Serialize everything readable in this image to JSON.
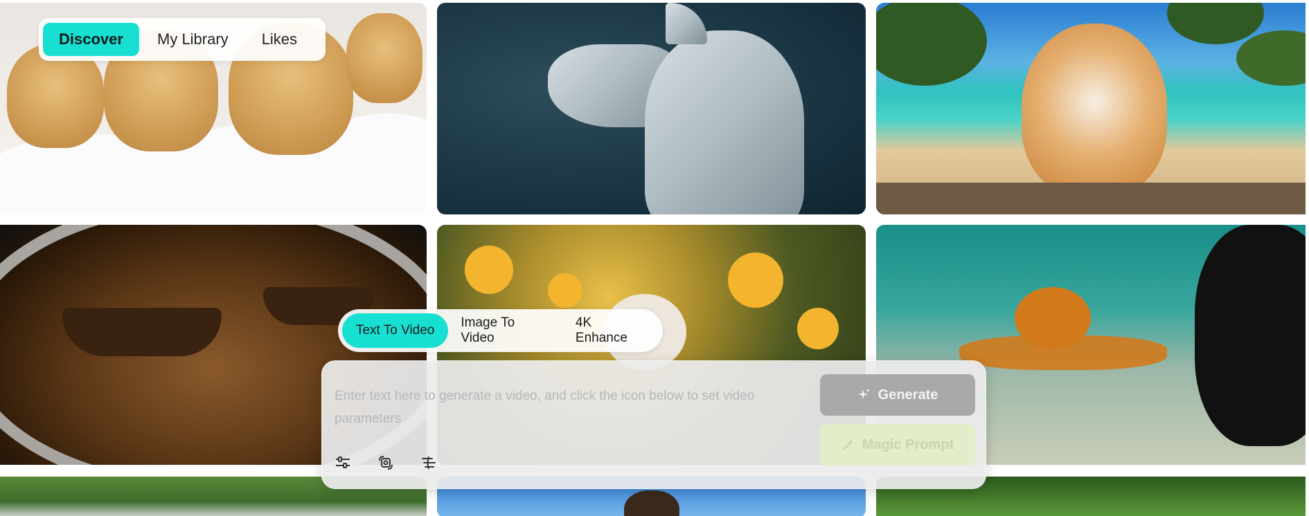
{
  "nav": {
    "tabs": [
      {
        "label": "Discover",
        "active": true
      },
      {
        "label": "My Library",
        "active": false
      },
      {
        "label": "Likes",
        "active": false
      }
    ]
  },
  "modes": {
    "tabs": [
      {
        "label": "Text To Video",
        "active": true
      },
      {
        "label": "Image To Video",
        "active": false
      },
      {
        "label": "4K Enhance",
        "active": false
      }
    ]
  },
  "composer": {
    "placeholder": "Enter text here to generate a video, and click the icon below to set video parameters",
    "generate_label": "Generate",
    "magic_label": "Magic Prompt",
    "tools": [
      {
        "icon": "sliders-icon"
      },
      {
        "icon": "camera-motion-icon"
      },
      {
        "icon": "filter-lines-icon"
      }
    ]
  },
  "colors": {
    "accent": "#17e0d2",
    "generate_bg": "#a9a9a9",
    "magic_bg": "#e3edc9"
  },
  "gallery": {
    "items": [
      {
        "subject": "puppies-in-snow"
      },
      {
        "subject": "white-dragon"
      },
      {
        "subject": "corgi-on-beach"
      },
      {
        "subject": "ships-in-coffee"
      },
      {
        "subject": "cat-in-flowers"
      },
      {
        "subject": "octopus-underwater"
      },
      {
        "subject": "waterfall"
      },
      {
        "subject": "otter-in-sun"
      },
      {
        "subject": "bamboo-in-glass"
      }
    ]
  }
}
